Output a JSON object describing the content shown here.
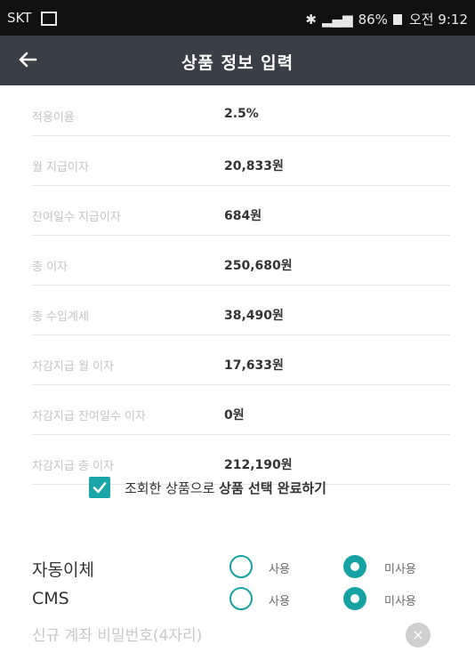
{
  "status_bar": {
    "carrier": "SKT",
    "battery": "86%",
    "time": "오전 9:12"
  },
  "header": {
    "title": "상품 정보 입력"
  },
  "details": [
    {
      "label": "적용이율",
      "value": "2.5%"
    },
    {
      "label": "월 지급이자",
      "value": "20,833원"
    },
    {
      "label": "잔여일수 지급이자",
      "value": "684원"
    },
    {
      "label": "총 이자",
      "value": "250,680원"
    },
    {
      "label": "총 수입계세",
      "value": "38,490원"
    },
    {
      "label": "차감지급 월 이자",
      "value": "17,633원"
    },
    {
      "label": "차감지급 잔여일수 이자",
      "value": "0원"
    },
    {
      "label": "차감지급 총 이자",
      "value": "212,190원"
    }
  ],
  "confirm": {
    "checked": true,
    "text_prefix": "조회한 상품으로 ",
    "text_bold": "상품 선택 완료하기"
  },
  "options": [
    {
      "label": "자동이체",
      "use": "사용",
      "no_use": "미사용",
      "selected": "미사용"
    },
    {
      "label": "CMS",
      "use": "사용",
      "no_use": "미사용",
      "selected": "미사용"
    }
  ],
  "password": {
    "placeholder": "신규 계좌 비밀번호(4자리)"
  },
  "colors": {
    "accent": "#17a2a2",
    "appbar": "#3a3e46",
    "statusbar": "#111111"
  }
}
